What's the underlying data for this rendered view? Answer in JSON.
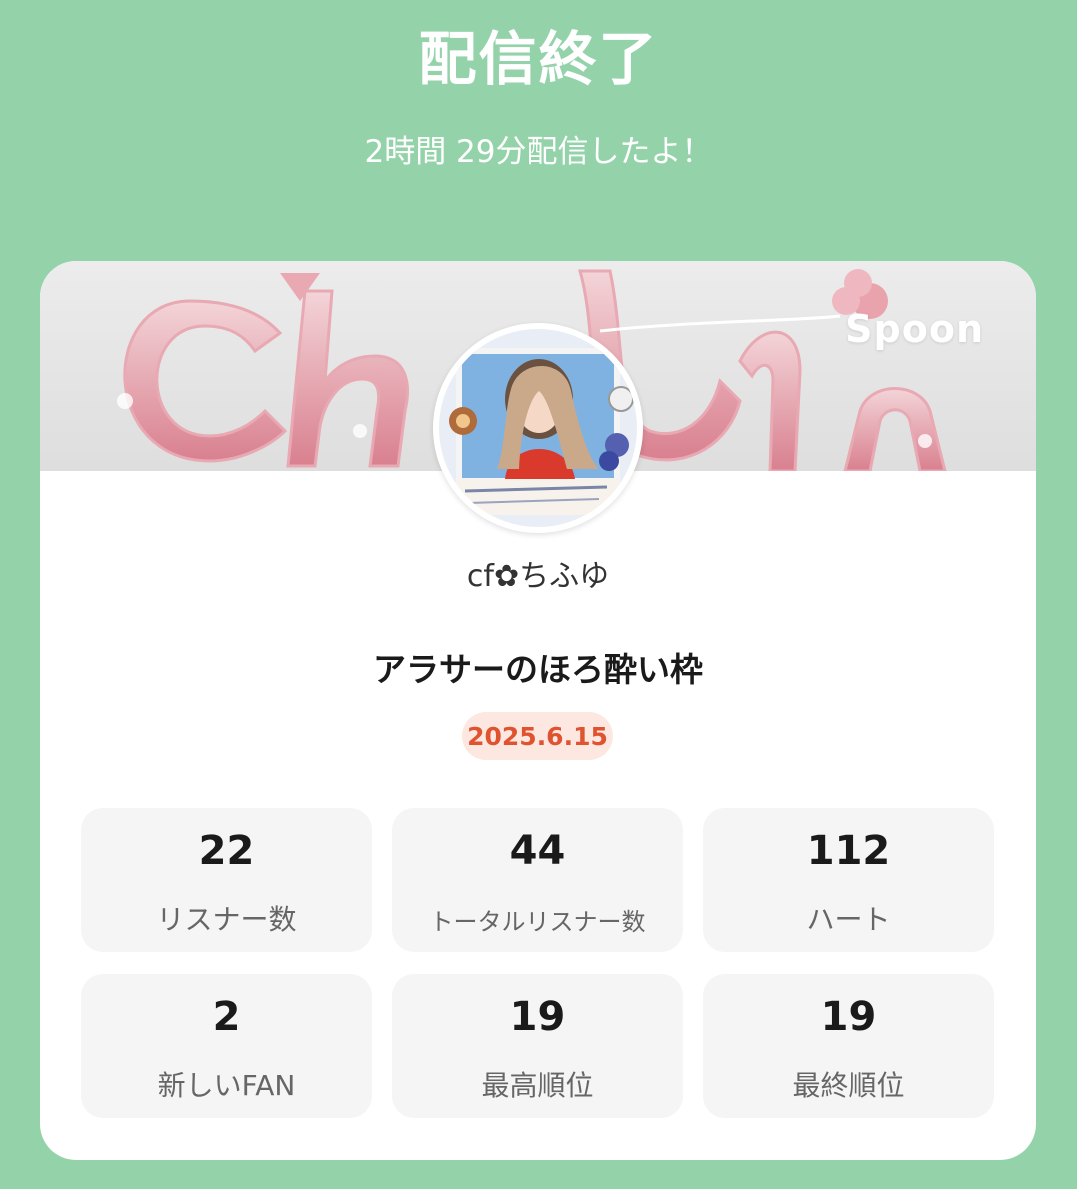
{
  "header": {
    "title": "配信終了",
    "subtitle": "2時間 29分配信したよ！"
  },
  "card": {
    "brand": "Spoon",
    "username": "cf✿ちふゆ",
    "stream_title": "アラサーのほろ酔い枠",
    "date": "2025.6.15"
  },
  "stats": [
    {
      "value": "22",
      "label": "リスナー数"
    },
    {
      "value": "44",
      "label": "トータルリスナー数"
    },
    {
      "value": "112",
      "label": "ハート"
    },
    {
      "value": "2",
      "label": "新しいFAN"
    },
    {
      "value": "19",
      "label": "最高順位"
    },
    {
      "value": "19",
      "label": "最終順位"
    }
  ],
  "colors": {
    "background": "#94d3aa",
    "card": "#ffffff",
    "stat_tile": "#f5f5f5",
    "date_badge_bg": "#fde7e1",
    "date_badge_text": "#e0532f"
  }
}
